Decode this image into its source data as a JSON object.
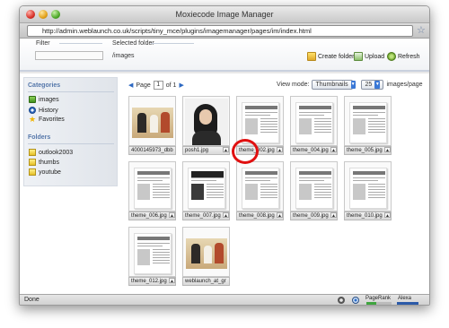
{
  "window": {
    "title": "Moxiecode Image Manager"
  },
  "browser": {
    "url": "http://admin.weblaunch.co.uk/scripts/tiny_mce/plugins/imagemanager/pages/im/index.html"
  },
  "toolbar": {
    "filter_label": "Filter",
    "filter_value": "",
    "selected_folder_label": "Selected folder",
    "selected_folder_value": "/images",
    "create_folder": "Create folder",
    "upload": "Upload",
    "refresh": "Refresh"
  },
  "sidebar": {
    "categories_title": "Categories",
    "categories": [
      {
        "label": "images",
        "icon": "images-icon"
      },
      {
        "label": "History",
        "icon": "history-icon"
      },
      {
        "label": "Favorites",
        "icon": "star-icon"
      }
    ],
    "folders_title": "Folders",
    "folders": [
      {
        "label": "outlook2003",
        "icon": "folder-icon"
      },
      {
        "label": "thumbs",
        "icon": "folder-icon"
      },
      {
        "label": "youtube",
        "icon": "folder-icon"
      }
    ]
  },
  "pager": {
    "page_label": "Page",
    "current_page": "1",
    "of_label": "of 1"
  },
  "view": {
    "mode_label": "View mode:",
    "mode_value": "Thumbnails",
    "per_page_value": "25",
    "per_page_suffix": "images/page"
  },
  "thumbnails": [
    {
      "name": "4000145973_dbb"
    },
    {
      "name": "posh1.jpg"
    },
    {
      "name": "theme_002.jpg"
    },
    {
      "name": "theme_004.jpg"
    },
    {
      "name": "theme_005.jpg"
    },
    {
      "name": "theme_006.jpg"
    },
    {
      "name": "theme_007.jpg"
    },
    {
      "name": "theme_008.jpg"
    },
    {
      "name": "theme_009.jpg"
    },
    {
      "name": "theme_010.jpg"
    },
    {
      "name": "theme_012.jpg"
    },
    {
      "name": "weblaunch_at_gr"
    }
  ],
  "status": {
    "text": "Done",
    "pagerank_label": "PageRank",
    "alexa_label": "Alexa"
  },
  "colors": {
    "accent": "#5577aa",
    "highlight_circle": "#e01010",
    "link": "#2e69c2"
  }
}
